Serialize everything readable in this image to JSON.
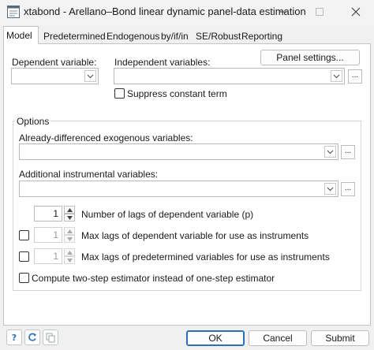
{
  "window": {
    "title": "xtabond - Arellano–Bond linear dynamic panel-data estimation",
    "icon": "dialog-app-icon",
    "controls": [
      "minimize-icon",
      "maximize-icon",
      "close-icon"
    ]
  },
  "tabs": [
    {
      "label": "Model",
      "active": true
    },
    {
      "label": "Predetermined",
      "active": false
    },
    {
      "label": "Endogenous",
      "active": false
    },
    {
      "label": "by/if/in",
      "active": false
    },
    {
      "label": "SE/Robust",
      "active": false
    },
    {
      "label": "Reporting",
      "active": false
    }
  ],
  "model": {
    "panel_settings_label": "Panel settings...",
    "dependent_label": "Dependent variable:",
    "dependent_value": "",
    "independent_label": "Independent variables:",
    "independent_value": "",
    "browse_label": "...",
    "suppress_label": "Suppress constant term",
    "suppress_checked": false
  },
  "options": {
    "legend": "Options",
    "diff_exog_label": "Already-differenced exogenous variables:",
    "diff_exog_value": "",
    "addl_instr_label": "Additional instrumental variables:",
    "addl_instr_value": "",
    "lags_value": "1",
    "lags_label": "Number of lags of dependent variable (p)",
    "maxlag_dep_value": "1",
    "maxlag_dep_label": "Max lags of dependent variable for use as instruments",
    "maxlag_dep_checked": false,
    "maxlag_pre_value": "1",
    "maxlag_pre_label": "Max lags of predetermined variables for use as instruments",
    "maxlag_pre_checked": false,
    "twostep_label": "Compute two-step estimator instead of one-step estimator",
    "twostep_checked": false
  },
  "footer": {
    "icons": [
      "help-icon",
      "reset-icon",
      "copy-icon"
    ],
    "ok_label": "OK",
    "cancel_label": "Cancel",
    "submit_label": "Submit"
  }
}
